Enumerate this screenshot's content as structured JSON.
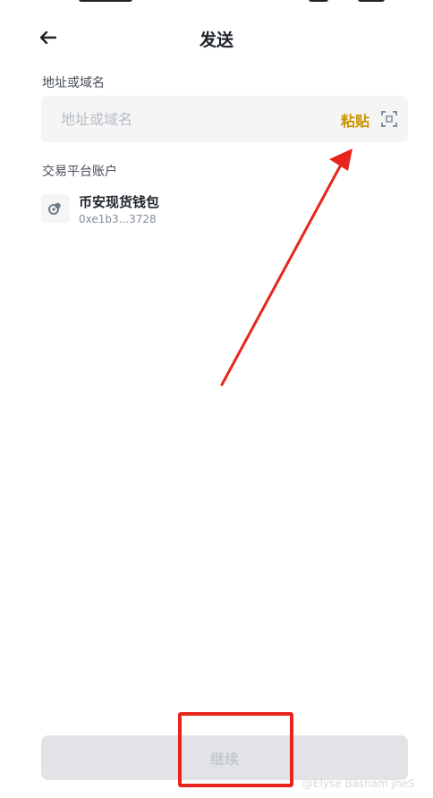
{
  "header": {
    "title": "发送"
  },
  "address": {
    "section_label": "地址或域名",
    "placeholder": "地址或域名",
    "value": "",
    "paste_label": "粘贴"
  },
  "exchange": {
    "section_label": "交易平台账户",
    "account": {
      "name": "币安现货钱包",
      "address": "0xe1b3...3728"
    }
  },
  "footer": {
    "continue_label": "继续"
  },
  "watermark": "@Elyse Basham JneS",
  "icons": {
    "back": "arrow-left-icon",
    "scan": "scan-icon",
    "wallet": "wallet-icon"
  },
  "colors": {
    "accent": "#c99400",
    "annotation_red": "#e8251c",
    "button_disabled_bg": "#e1e3e7"
  }
}
